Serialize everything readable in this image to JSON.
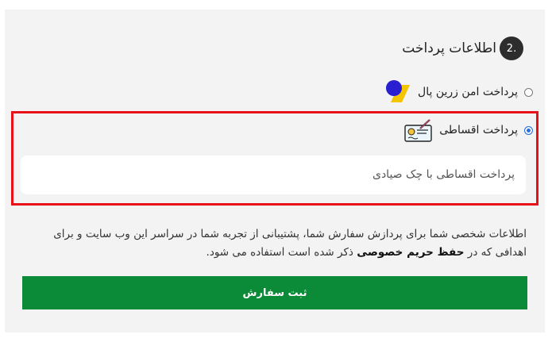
{
  "section": {
    "step_number": "2.",
    "title": "اطلاعات پرداخت"
  },
  "payment_options": [
    {
      "label": "پرداخت امن زرین پال",
      "selected": false,
      "icon": "zarinpal-logo"
    },
    {
      "label": "پرداخت اقساطی",
      "selected": true,
      "icon": "cheque-icon"
    }
  ],
  "selected_description": "پرداخت اقساطی با چک صیادی",
  "privacy": {
    "text_before": "اطلاعات شخصی شما برای پردازش سفارش شما، پشتیبانی از تجربه شما در سراسر این وب سایت و برای اهدافی که در",
    "link_text": "حفظ حریم خصوصی",
    "text_after": "ذکر شده است استفاده می شود."
  },
  "submit_label": "ثبت سفارش",
  "colors": {
    "accent_green": "#0b8a38",
    "highlight_red": "#e8111a",
    "radio_blue": "#2a6fe0"
  }
}
